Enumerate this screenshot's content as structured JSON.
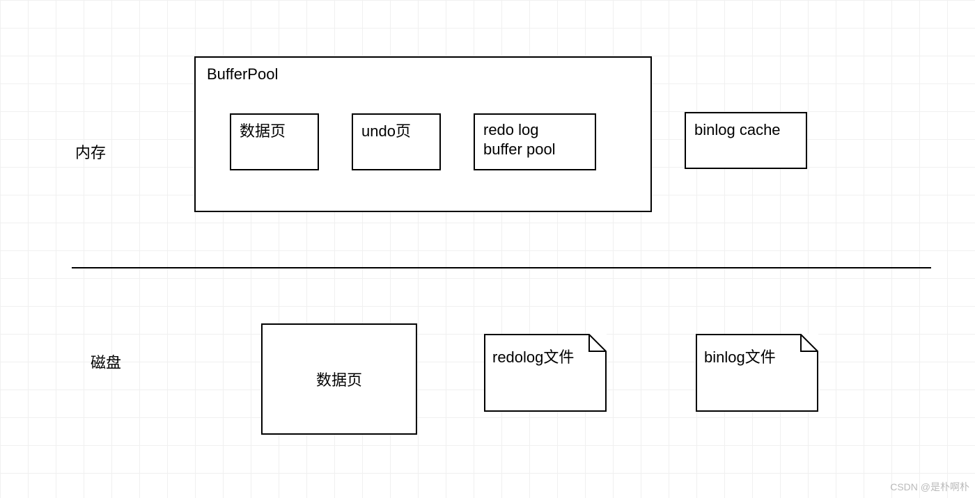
{
  "memory": {
    "label": "内存",
    "bufferpool": {
      "title": "BufferPool",
      "items": {
        "data_page": "数据页",
        "undo_page": "undo页",
        "redo_buffer_line1": "redo log",
        "redo_buffer_line2": "buffer pool"
      }
    },
    "binlog_cache": "binlog cache"
  },
  "disk": {
    "label": "磁盘",
    "data_page": "数据页",
    "redolog_file": "redolog文件",
    "binlog_file": "binlog文件"
  },
  "watermark": "CSDN @是朴啊朴"
}
